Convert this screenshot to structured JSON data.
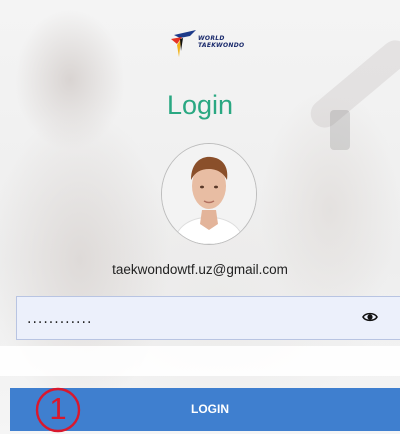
{
  "brand": {
    "line1": "WORLD",
    "line2": "TAEKWONDO"
  },
  "login": {
    "title": "Login",
    "email": "taekwondowtf.uz@gmail.com",
    "password_value": "............",
    "button_label": "LOGIN"
  },
  "annotation": {
    "step_number": "1"
  },
  "colors": {
    "title": "#2aa882",
    "button": "#3f7fcf",
    "annotation": "#d9182d",
    "input_bg": "#ecf0fb"
  },
  "icons": {
    "password_toggle": "eye-icon",
    "brand_logo": "world-taekwondo-logo"
  }
}
